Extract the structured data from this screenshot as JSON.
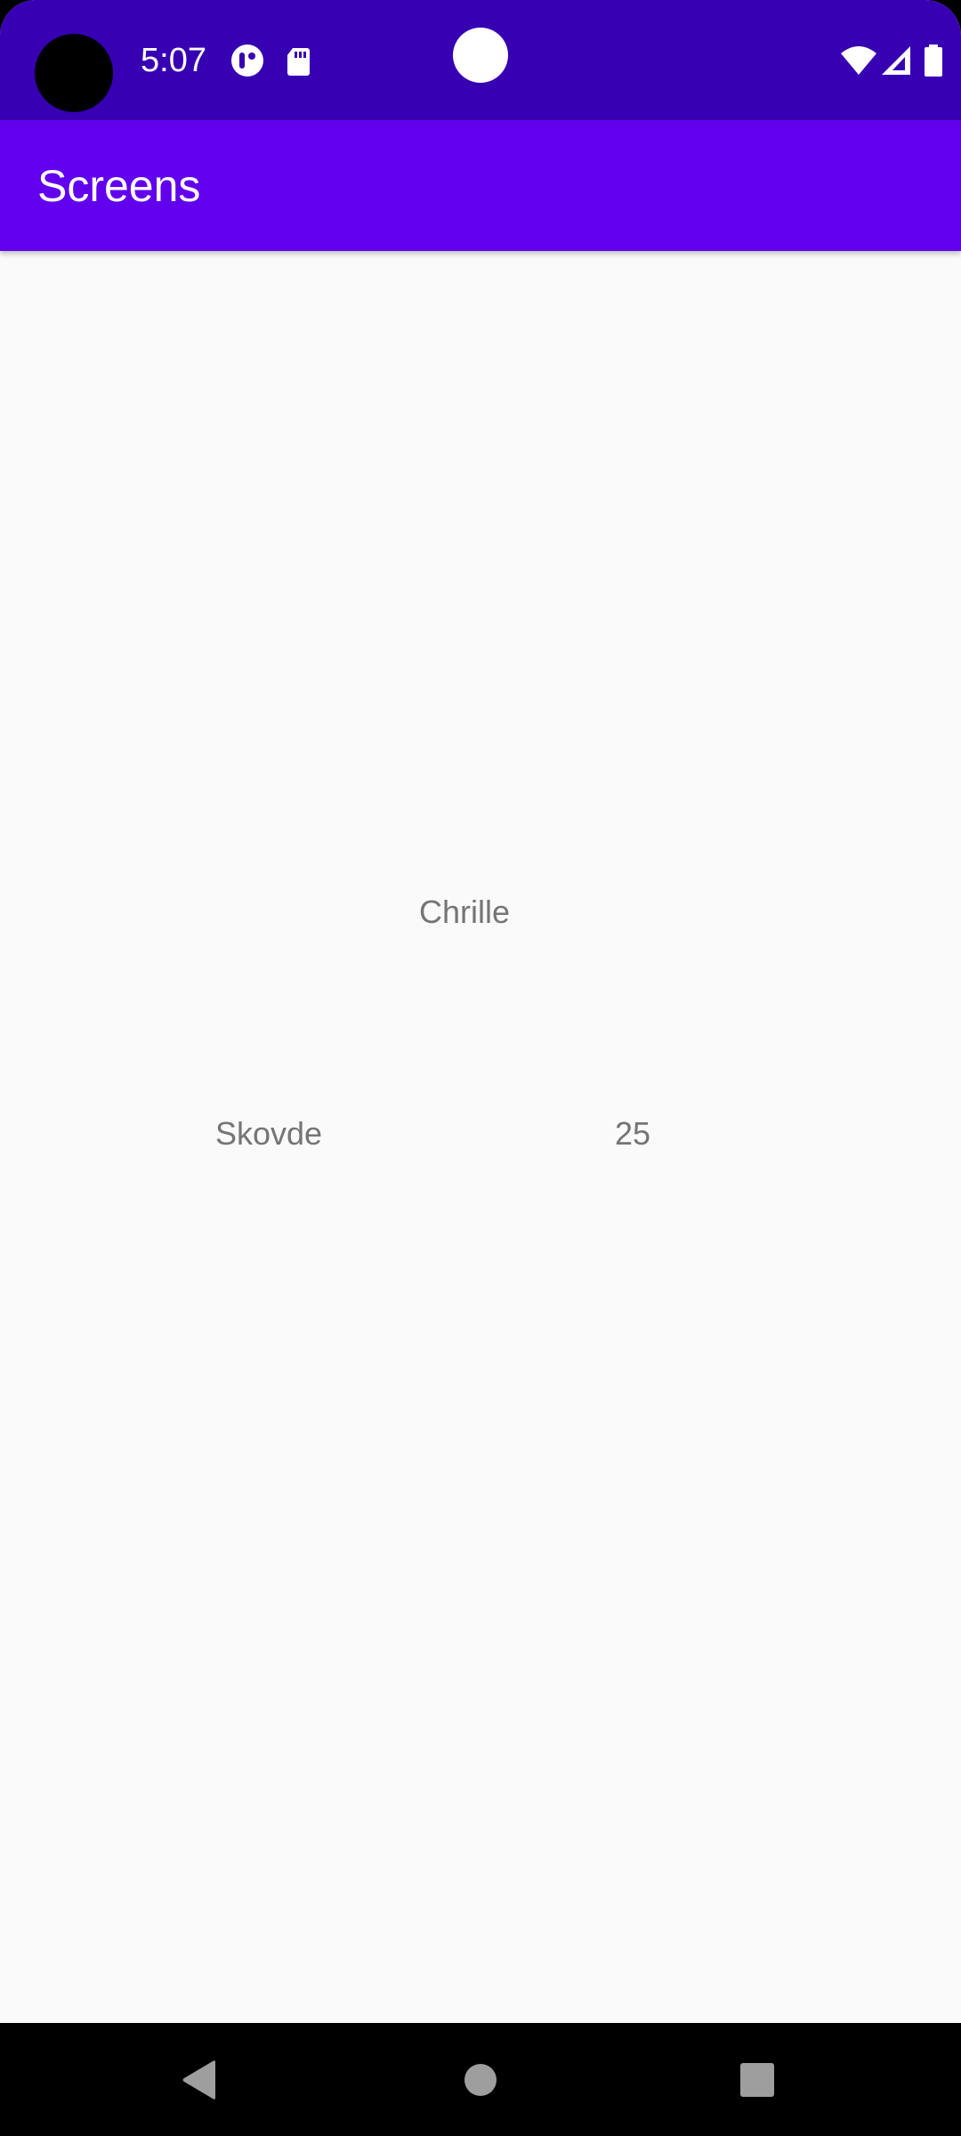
{
  "status_bar": {
    "time": "5:07",
    "icons": [
      "camera-cutout",
      "data-saver-icon",
      "sd-card-icon",
      "wifi-icon",
      "cell-signal-icon",
      "battery-icon"
    ],
    "background": "#3700b3"
  },
  "app_bar": {
    "title": "Screens",
    "background": "#6200ee"
  },
  "content": {
    "name": "Chrille",
    "city": "Skovde",
    "age": "25",
    "text_color": "#757575",
    "background": "#fafafa"
  },
  "nav_bar": {
    "buttons": [
      "back-icon",
      "home-icon",
      "recents-icon"
    ]
  }
}
